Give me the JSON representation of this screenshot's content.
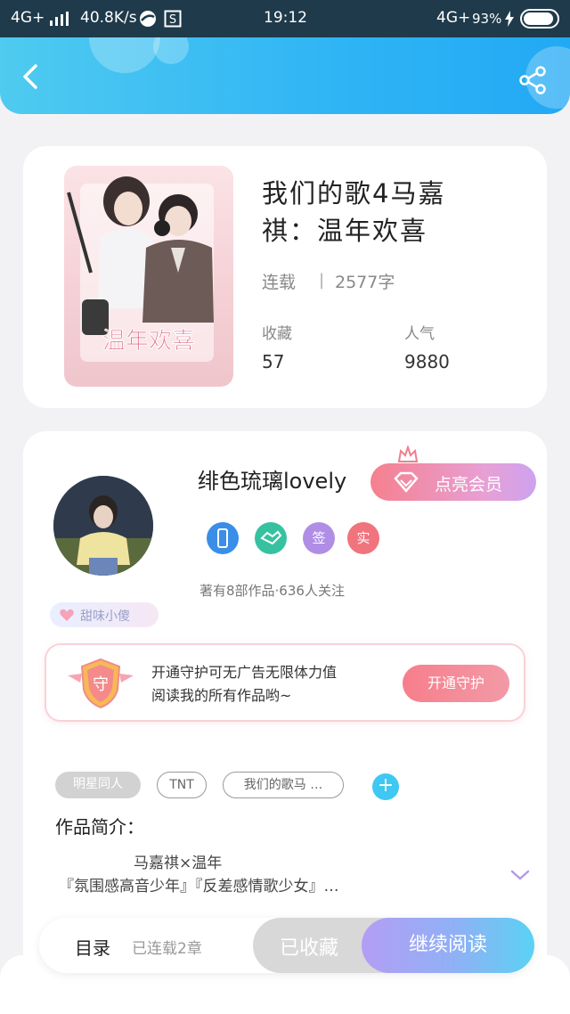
{
  "status_bar": {
    "network": "4G+",
    "speed": "40.8K/s",
    "time": "19:12",
    "network_right": "4G+",
    "battery": "93%",
    "battery_level": 0.93
  },
  "book": {
    "title_line1": "我们的歌4马嘉",
    "title_line2": "祺：温年欢喜",
    "status": "连载",
    "separator": "|",
    "word_count": "2577字",
    "favorites_label": "收藏",
    "favorites_value": "57",
    "popularity_label": "人气",
    "popularity_value": "9880",
    "cover_text": "温年欢喜"
  },
  "author": {
    "name": "绯色琉璃lovely",
    "vip_label": "点亮会员",
    "badges": [
      {
        "icon": "phone-badge-icon",
        "color": "#3a8ee8"
      },
      {
        "icon": "handshake-badge-icon",
        "color": "#36c2a0"
      },
      {
        "icon": "sign-badge-icon",
        "text": "签",
        "color": "#b08ee6"
      },
      {
        "icon": "verified-badge-icon",
        "text": "实",
        "color": "#f0737e"
      }
    ],
    "meta": "著有8部作品·636人关注",
    "tag": "甜味小傻"
  },
  "guard": {
    "line1": "开通守护可无广告无限体力值",
    "line2": "阅读我的所有作品哟~",
    "button": "开通守护",
    "badge_char": "守"
  },
  "tags": [
    "明星同人",
    "TNT",
    "我们的歌马 …"
  ],
  "intro": {
    "title": "作品简介：",
    "line1": "马嘉祺×温年",
    "line2": "『氛围感高音少年』『反差感情歌少女』…"
  },
  "bottom_bar": {
    "toc": "目录",
    "chapters": "已连载2章",
    "collected": "已收藏",
    "continue": "继续阅读"
  },
  "colors": {
    "header": "#2fb4f5",
    "vip": "#f5808e",
    "guard_button": "#f77e8c",
    "read_button": "#8fb1f5"
  }
}
